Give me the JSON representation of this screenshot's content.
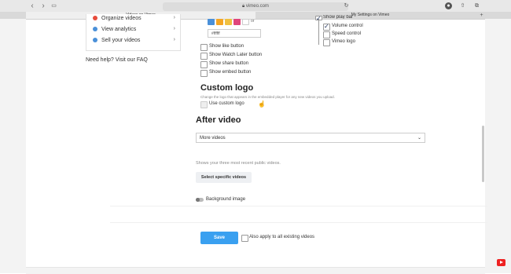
{
  "browser": {
    "url": "vimeo.com",
    "tabs": [
      {
        "label": "Videos on Vimeo",
        "active": true
      },
      {
        "label": "My Settings on Vimeo",
        "active": false
      }
    ]
  },
  "sidebar": {
    "items": [
      {
        "label": "Organize videos",
        "icon": "organize-icon",
        "color": "#e74c3c"
      },
      {
        "label": "View analytics",
        "icon": "analytics-icon",
        "color": "#4a90d9"
      },
      {
        "label": "Sell your videos",
        "icon": "sell-icon",
        "color": "#4a90d9"
      }
    ],
    "help": "Need help? Visit our FAQ"
  },
  "colors": {
    "swatches": [
      "#4a90d9",
      "#f5a623",
      "#f0c040",
      "#b8d44a",
      "#e0457b",
      "#ffffff"
    ],
    "swatch_suffix": "or",
    "hex_value": "#ffffff"
  },
  "checkboxes": {
    "like": "Show like button",
    "watch_later": "Show Watch Later button",
    "share": "Show share button",
    "embed": "Show embed button"
  },
  "playbar": {
    "show_play_bar": "Show play bar",
    "volume": "Volume control",
    "speed": "Speed control",
    "logo": "Vimeo logo"
  },
  "custom_logo": {
    "title": "Custom logo",
    "subtitle": "Change the logo that appears in the embedded player for any new videos you upload.",
    "use_label": "Use custom logo"
  },
  "after_video": {
    "title": "After video",
    "selected": "More videos",
    "description": "Shows your three most recent public videos.",
    "select_button": "Select specific videos",
    "background_label": "Background image"
  },
  "footer": {
    "save": "Save",
    "apply_all": "Also apply to all existing videos"
  }
}
